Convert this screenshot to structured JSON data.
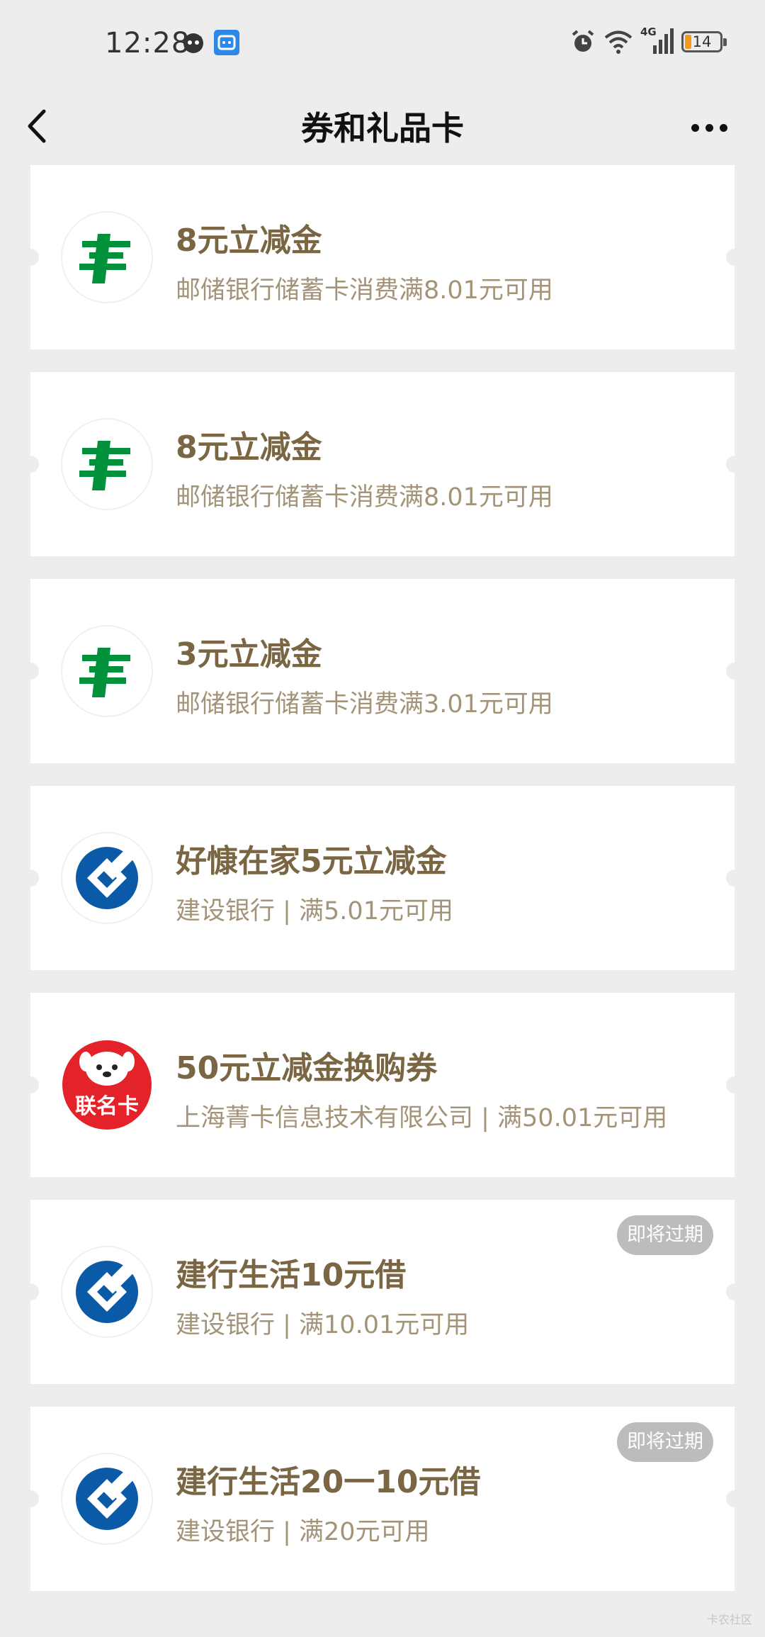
{
  "status_bar": {
    "time": "12:28",
    "network": "4G",
    "battery": "14"
  },
  "nav": {
    "title": "券和礼品卡"
  },
  "cards": [
    {
      "title": "8元立减金",
      "desc": "邮储银行储蓄卡消费满8.01元可用",
      "logo": "postal-bank-logo"
    },
    {
      "title": "8元立减金",
      "desc": "邮储银行储蓄卡消费满8.01元可用",
      "logo": "postal-bank-logo"
    },
    {
      "title": "3元立减金",
      "desc": "邮储银行储蓄卡消费满3.01元可用",
      "logo": "postal-bank-logo"
    },
    {
      "title": "好慷在家5元立减金",
      "desc": "建设银行 | 满5.01元可用",
      "logo": "ccb-logo"
    },
    {
      "title": "50元立减金换购券",
      "desc": "上海菁卡信息技术有限公司 | 满50.01元可用",
      "logo": "lianmingka-logo",
      "logo_text": "联名卡"
    },
    {
      "title": "建行生活10元借",
      "desc": "建设银行 | 满10.01元可用",
      "badge": "即将过期",
      "logo": "ccb-logo"
    },
    {
      "title": "建行生活20一10元借",
      "desc": "建设银行 | 满20元可用",
      "badge": "即将过期",
      "logo": "ccb-logo"
    }
  ],
  "watermark": "卡农社区",
  "colors": {
    "title": "#7a6643",
    "desc": "#a39479",
    "postal_green": "#00913a",
    "ccb_blue": "#0a5aa8",
    "badge_bg": "#bcbcbc",
    "page_bg": "#ededed"
  }
}
